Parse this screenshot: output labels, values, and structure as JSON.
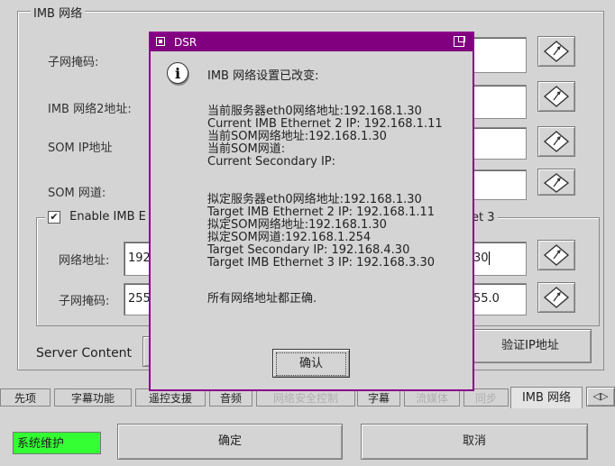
{
  "imb_network": {
    "group_title": "IMB 网络",
    "subnet_mask_label": "子网掩码:",
    "imb_network2_address_label": "IMB 网络2地址:",
    "som_ip_label": "SOM IP地址",
    "som_gateway_label": "SOM 网道:",
    "enable_label_visible": "Enable IMB E",
    "enable_right_fragment": "et 3",
    "network_address_label": "网络地址:",
    "network_address_value_left": "192",
    "network_address_value_right": "30",
    "subnet_mask2_label": "子网掩码:",
    "subnet_mask2_value_left": "255",
    "subnet_mask2_value_right": "55.0",
    "server_content_label": "Server Content",
    "verify_ip_button": "验证IP地址"
  },
  "tabs": [
    {
      "label": "先项",
      "dim": false
    },
    {
      "label": "字幕功能",
      "dim": false
    },
    {
      "label": "遥控支援",
      "dim": false
    },
    {
      "label": "音频",
      "dim": false
    },
    {
      "label": "网络安全控制",
      "dim": true
    },
    {
      "label": "字幕",
      "dim": false
    },
    {
      "label": "流媒体",
      "dim": true
    },
    {
      "label": "同步",
      "dim": true
    },
    {
      "label": "IMB 网络",
      "dim": false
    }
  ],
  "footer": {
    "status": "系统维护",
    "ok_button": "确定",
    "cancel_button": "取消"
  },
  "dialog": {
    "title": "DSR",
    "heading": "IMB 网络设置已改变:",
    "current_lines": [
      "当前服务器eth0网络地址:192.168.1.30",
      "Current IMB Ethernet 2 IP: 192.168.1.11",
      "当前SOM网络地址:192.168.1.30",
      "当前SOM网道:",
      "Current Secondary IP:"
    ],
    "target_lines": [
      "拟定服务器eth0网络地址:192.168.1.30",
      "Target IMB Ethernet 2 IP: 192.168.1.11",
      "拟定SOM网络地址:192.168.1.30",
      "拟定SOM网道:192.168.1.254",
      "Target Secondary IP: 192.168.4.30",
      "Target IMB Ethernet 3 IP: 192.168.3.30"
    ],
    "footer_text": "所有网络地址都正确.",
    "confirm_button": "确认"
  },
  "colors": {
    "dialog_border": "#8b008b",
    "titlebar": "#800080",
    "status_green": "#33ff33"
  }
}
